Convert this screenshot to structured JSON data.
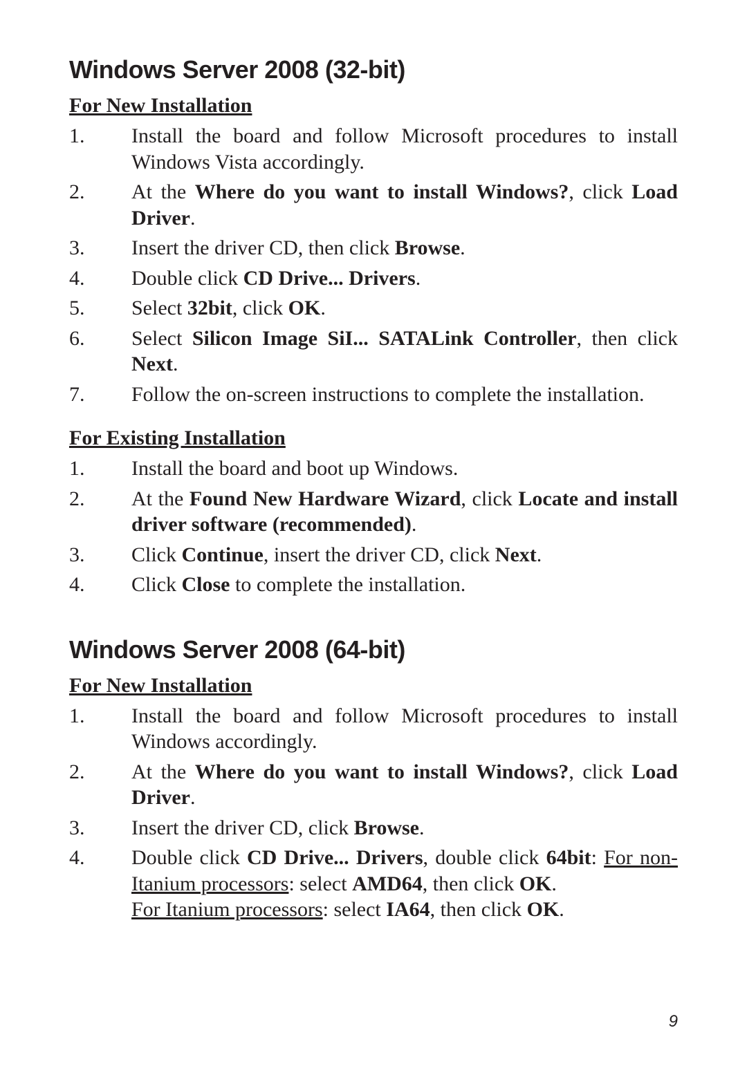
{
  "sections": [
    {
      "title": "Windows Server 2008 (32-bit)",
      "subsections": [
        {
          "heading": "For New Installation",
          "steps": [
            {
              "n": "1.",
              "html": "Install the board and follow Microsoft procedures to install Windows Vista accordingly."
            },
            {
              "n": "2.",
              "html": "At the <span class=\"b\">Where do you want to install Windows?</span>, click <span class=\"b\">Load Driver</span>."
            },
            {
              "n": "3.",
              "html": "Insert the driver CD, then click <span class=\"b\">Browse</span>."
            },
            {
              "n": "4.",
              "html": "Double click <span class=\"b\">CD Drive... Drivers</span>."
            },
            {
              "n": "5.",
              "html": "Select <span class=\"b\">32bit</span>, click <span class=\"b\">OK</span>."
            },
            {
              "n": "6.",
              "html": "Select <span class=\"b\">Silicon Image SiI... SATALink Controller</span>, then click <span class=\"b\">Next</span>."
            },
            {
              "n": "7.",
              "html": "Follow the on-screen instructions to complete the installation."
            }
          ]
        },
        {
          "heading": "For Existing Installation",
          "steps": [
            {
              "n": "1.",
              "html": "Install the board and boot up Windows."
            },
            {
              "n": "2.",
              "html": "At the <span class=\"b\">Found New Hardware Wizard</span>, click <span class=\"b\">Locate and install driver software (recommended)</span>."
            },
            {
              "n": "3.",
              "html": "Click <span class=\"b\">Continue</span>, insert the driver CD, click <span class=\"b\">Next</span>."
            },
            {
              "n": "4.",
              "html": "Click <span class=\"b\">Close</span> to complete the installation."
            }
          ]
        }
      ]
    },
    {
      "title": "Windows Server 2008 (64-bit)",
      "subsections": [
        {
          "heading": "For New Installation",
          "steps": [
            {
              "n": "1.",
              "html": "Install the board and follow Microsoft procedures to install Windows accordingly."
            },
            {
              "n": "2.",
              "html": "At the <span class=\"b\">Where do you want to install Windows?</span>, click <span class=\"b\">Load Driver</span>."
            },
            {
              "n": "3.",
              "html": "Insert the driver CD, click <span class=\"b\">Browse</span>."
            },
            {
              "n": "4.",
              "html": "Double click <span class=\"b\">CD Drive... Drivers</span>, double click <span class=\"b\">64bit</span>: <span class=\"u\">For non-Itanium processors</span>: select <span class=\"b\">AMD64</span>, then click <span class=\"b\">OK</span>.<br><span class=\"u\">For Itanium processors</span>: select <span class=\"b\">IA64</span>, then click <span class=\"b\">OK</span>."
            }
          ]
        }
      ]
    }
  ],
  "page_number": "9"
}
